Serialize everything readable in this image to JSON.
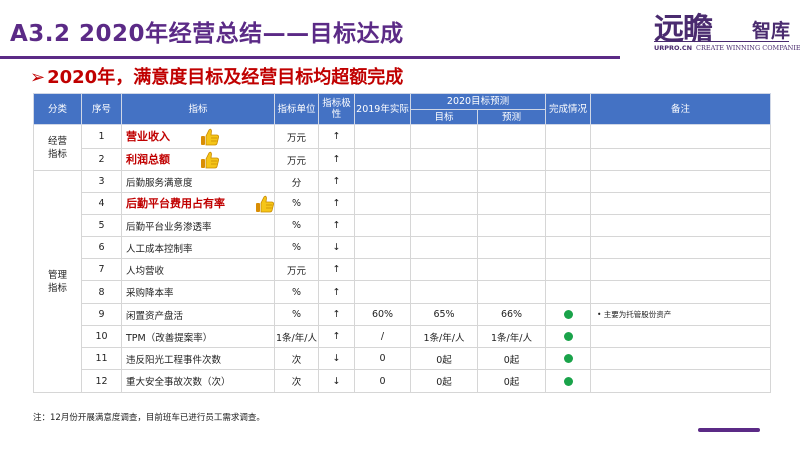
{
  "header": {
    "title": "A3.2  2020年经营总结——目标达成",
    "logo": {
      "brand": "远瞻",
      "suffix": "智库",
      "url": "URPRO.CN",
      "tagline": "CREATE WINNING COMPANIES"
    }
  },
  "subtitle": {
    "arrow": "➢",
    "text": "2020年，满意度目标及经营目标均超额完成"
  },
  "table": {
    "headers": {
      "category": "分类",
      "index": "序号",
      "indicator": "指标",
      "unit": "指标单位",
      "polarity": "指标极性",
      "actual_2019": "2019年实际",
      "forecast_2020": "2020目标预测",
      "target": "目标",
      "forecast": "预测",
      "completion": "完成情况",
      "note": "备注"
    },
    "groups": [
      {
        "label": "经营指标"
      },
      {
        "label": "管理指标"
      }
    ],
    "rows": [
      {
        "no": "1",
        "name": "营业收入",
        "unit": "万元",
        "pol": "↑",
        "a2019": "",
        "target": "",
        "forecast": "",
        "done": false,
        "note": "",
        "highlight": true,
        "thumb": true
      },
      {
        "no": "2",
        "name": "利润总额",
        "unit": "万元",
        "pol": "↑",
        "a2019": "",
        "target": "",
        "forecast": "",
        "done": false,
        "note": "",
        "highlight": true,
        "thumb": true
      },
      {
        "no": "3",
        "name": "后勤服务满意度",
        "unit": "分",
        "pol": "↑",
        "a2019": "",
        "target": "",
        "forecast": "",
        "done": false,
        "note": "",
        "highlight": false,
        "thumb": false
      },
      {
        "no": "4",
        "name": "后勤平台费用占有率",
        "unit": "%",
        "pol": "↑",
        "a2019": "",
        "target": "",
        "forecast": "",
        "done": false,
        "note": "",
        "highlight": true,
        "thumb": true
      },
      {
        "no": "5",
        "name": "后勤平台业务渗透率",
        "unit": "%",
        "pol": "↑",
        "a2019": "",
        "target": "",
        "forecast": "",
        "done": false,
        "note": "",
        "highlight": false,
        "thumb": false
      },
      {
        "no": "6",
        "name": "人工成本控制率",
        "unit": "%",
        "pol": "↓",
        "a2019": "",
        "target": "",
        "forecast": "",
        "done": false,
        "note": "",
        "highlight": false,
        "thumb": false
      },
      {
        "no": "7",
        "name": "人均营收",
        "unit": "万元",
        "pol": "↑",
        "a2019": "",
        "target": "",
        "forecast": "",
        "done": false,
        "note": "",
        "highlight": false,
        "thumb": false
      },
      {
        "no": "8",
        "name": "采购降本率",
        "unit": "%",
        "pol": "↑",
        "a2019": "",
        "target": "",
        "forecast": "",
        "done": false,
        "note": "",
        "highlight": false,
        "thumb": false
      },
      {
        "no": "9",
        "name": "闲置资产盘活",
        "unit": "%",
        "pol": "↑",
        "a2019": "60%",
        "target": "65%",
        "forecast": "66%",
        "done": true,
        "note": "•    主要为托管股份资产",
        "highlight": false,
        "thumb": false
      },
      {
        "no": "10",
        "name": "TPM（改善提案率）",
        "unit": "1条/年/人",
        "pol": "↑",
        "a2019": "/",
        "target": "1条/年/人",
        "forecast": "1条/年/人",
        "done": true,
        "note": "",
        "highlight": false,
        "thumb": false
      },
      {
        "no": "11",
        "name": "违反阳光工程事件次数",
        "unit": "次",
        "pol": "↓",
        "a2019": "0",
        "target": "0起",
        "forecast": "0起",
        "done": true,
        "note": "",
        "highlight": false,
        "thumb": false
      },
      {
        "no": "12",
        "name": "重大安全事故次数（次）",
        "unit": "次",
        "pol": "↓",
        "a2019": "0",
        "target": "0起",
        "forecast": "0起",
        "done": true,
        "note": "",
        "highlight": false,
        "thumb": false
      }
    ]
  },
  "footer": {
    "note": "注：12月份开展满意度调查，目前班车已进行员工需求调查。"
  },
  "colors": {
    "title": "#5b2a86",
    "header_bg": "#4472c4",
    "highlight": "#c00000",
    "done_dot": "#1aa34a",
    "thumb": "#f2b705"
  },
  "icons": {
    "thumb": "thumbs-up-icon",
    "done": "green-dot-icon"
  }
}
